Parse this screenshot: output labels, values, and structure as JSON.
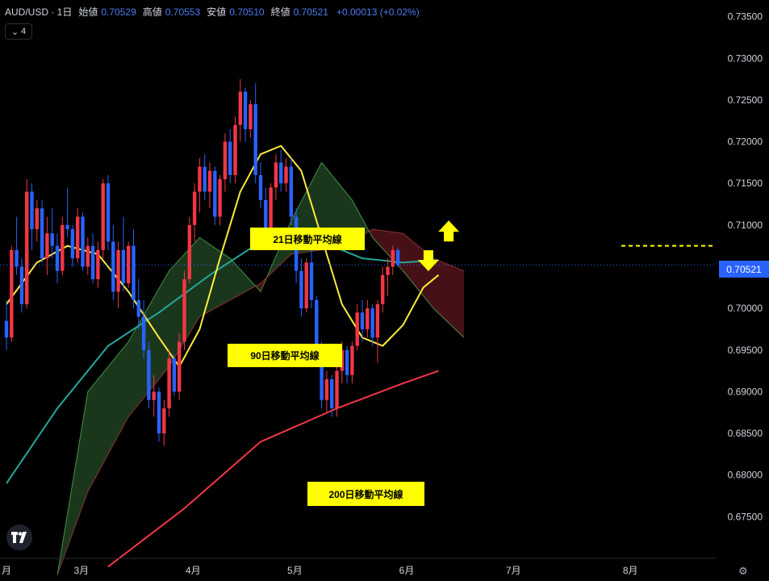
{
  "header": {
    "symbol": "AUD/USD · 1日",
    "open_label": "始値",
    "open": "0.70529",
    "high_label": "高値",
    "high": "0.70553",
    "low_label": "安値",
    "low": "0.70510",
    "close_label": "終値",
    "close": "0.70521",
    "change": "+0.00013 (+0.02%)"
  },
  "collapse_control": {
    "label": "4"
  },
  "current_price": "0.70521",
  "annotations": {
    "ma21": "21日移動平均線",
    "ma90": "90日移動平均線",
    "ma200": "200日移動平均線"
  },
  "icons": {
    "logo": "tradingview-logo-icon",
    "settings": "gear-icon"
  },
  "chart_data": {
    "type": "candlestick",
    "y_range": [
      0.67,
      0.737
    ],
    "y_ticks": [
      "0.73500",
      "0.73000",
      "0.72500",
      "0.72000",
      "0.71500",
      "0.71000",
      "0.70500",
      "0.70000",
      "0.69500",
      "0.69000",
      "0.68500",
      "0.68000",
      "0.67500"
    ],
    "x_labels": [
      {
        "label": "3月",
        "bar": 16
      },
      {
        "label": "4月",
        "bar": 38
      },
      {
        "label": "5月",
        "bar": 58
      },
      {
        "label": "6月",
        "bar": 80
      },
      {
        "label": "7月",
        "bar": 101
      },
      {
        "label": "8月",
        "bar": 124
      }
    ],
    "x_labels_prefix": "月",
    "colors": {
      "up": "#f23645",
      "down": "#2962ff",
      "ma21": "#ffeb3b",
      "ma90": "#26a69a",
      "ma200": "#f23645",
      "kijun_like": "#7cb342",
      "cloud_bull": "#1b3a1e",
      "cloud_bear": "#4a1217",
      "price_line": "#2962ff",
      "arrow": "#ffff00"
    },
    "candles": [
      [
        0.6985,
        0.701,
        0.695,
        0.6965
      ],
      [
        0.6965,
        0.7075,
        0.696,
        0.707
      ],
      [
        0.707,
        0.711,
        0.704,
        0.705
      ],
      [
        0.705,
        0.706,
        0.6995,
        0.7005
      ],
      [
        0.7005,
        0.7155,
        0.7,
        0.714
      ],
      [
        0.714,
        0.715,
        0.707,
        0.7095
      ],
      [
        0.7095,
        0.713,
        0.708,
        0.712
      ],
      [
        0.712,
        0.713,
        0.7055,
        0.706
      ],
      [
        0.706,
        0.711,
        0.704,
        0.709
      ],
      [
        0.709,
        0.712,
        0.706,
        0.7075
      ],
      [
        0.7075,
        0.709,
        0.703,
        0.7045
      ],
      [
        0.7045,
        0.711,
        0.704,
        0.71
      ],
      [
        0.71,
        0.7145,
        0.7085,
        0.7095
      ],
      [
        0.7095,
        0.71,
        0.705,
        0.706
      ],
      [
        0.706,
        0.712,
        0.7055,
        0.711
      ],
      [
        0.711,
        0.7115,
        0.7045,
        0.705
      ],
      [
        0.705,
        0.7085,
        0.704,
        0.7075
      ],
      [
        0.7075,
        0.709,
        0.703,
        0.7035
      ],
      [
        0.7035,
        0.708,
        0.7025,
        0.707
      ],
      [
        0.707,
        0.7155,
        0.706,
        0.715
      ],
      [
        0.715,
        0.716,
        0.707,
        0.708
      ],
      [
        0.708,
        0.71,
        0.701,
        0.702
      ],
      [
        0.702,
        0.708,
        0.7,
        0.707
      ],
      [
        0.707,
        0.711,
        0.702,
        0.703
      ],
      [
        0.703,
        0.708,
        0.7025,
        0.7075
      ],
      [
        0.7075,
        0.7095,
        0.7,
        0.701
      ],
      [
        0.701,
        0.7035,
        0.6975,
        0.699
      ],
      [
        0.699,
        0.701,
        0.694,
        0.695
      ],
      [
        0.695,
        0.696,
        0.688,
        0.689
      ],
      [
        0.689,
        0.692,
        0.687,
        0.69
      ],
      [
        0.69,
        0.6905,
        0.684,
        0.685
      ],
      [
        0.685,
        0.689,
        0.6835,
        0.688
      ],
      [
        0.688,
        0.695,
        0.687,
        0.694
      ],
      [
        0.694,
        0.6945,
        0.6895,
        0.69
      ],
      [
        0.69,
        0.697,
        0.689,
        0.696
      ],
      [
        0.696,
        0.7045,
        0.695,
        0.7035
      ],
      [
        0.7035,
        0.711,
        0.703,
        0.71
      ],
      [
        0.71,
        0.715,
        0.708,
        0.714
      ],
      [
        0.714,
        0.718,
        0.7115,
        0.717
      ],
      [
        0.717,
        0.7185,
        0.713,
        0.714
      ],
      [
        0.714,
        0.7175,
        0.712,
        0.7165
      ],
      [
        0.7165,
        0.717,
        0.71,
        0.711
      ],
      [
        0.711,
        0.716,
        0.71,
        0.7155
      ],
      [
        0.7155,
        0.721,
        0.714,
        0.72
      ],
      [
        0.72,
        0.7215,
        0.715,
        0.716
      ],
      [
        0.716,
        0.723,
        0.715,
        0.722
      ],
      [
        0.722,
        0.7275,
        0.72,
        0.726
      ],
      [
        0.726,
        0.7265,
        0.72,
        0.7215
      ],
      [
        0.7215,
        0.725,
        0.7205,
        0.7245
      ],
      [
        0.7245,
        0.727,
        0.715,
        0.716
      ],
      [
        0.716,
        0.7175,
        0.712,
        0.713
      ],
      [
        0.713,
        0.7145,
        0.708,
        0.7095
      ],
      [
        0.7095,
        0.715,
        0.709,
        0.7145
      ],
      [
        0.7145,
        0.7185,
        0.713,
        0.7175
      ],
      [
        0.7175,
        0.719,
        0.714,
        0.715
      ],
      [
        0.715,
        0.718,
        0.714,
        0.717
      ],
      [
        0.717,
        0.718,
        0.71,
        0.711
      ],
      [
        0.711,
        0.712,
        0.703,
        0.7045
      ],
      [
        0.7045,
        0.706,
        0.699,
        0.7
      ],
      [
        0.7,
        0.706,
        0.6995,
        0.7055
      ],
      [
        0.7055,
        0.707,
        0.7,
        0.701
      ],
      [
        0.701,
        0.7015,
        0.694,
        0.695
      ],
      [
        0.695,
        0.696,
        0.688,
        0.689
      ],
      [
        0.689,
        0.6925,
        0.6875,
        0.6915
      ],
      [
        0.6915,
        0.692,
        0.687,
        0.688
      ],
      [
        0.688,
        0.693,
        0.687,
        0.6925
      ],
      [
        0.6925,
        0.696,
        0.691,
        0.695
      ],
      [
        0.695,
        0.6955,
        0.691,
        0.692
      ],
      [
        0.692,
        0.696,
        0.691,
        0.6955
      ],
      [
        0.6955,
        0.7005,
        0.695,
        0.6995
      ],
      [
        0.6995,
        0.701,
        0.696,
        0.6975
      ],
      [
        0.6975,
        0.701,
        0.6965,
        0.7
      ],
      [
        0.7,
        0.7005,
        0.6955,
        0.6965
      ],
      [
        0.6965,
        0.701,
        0.6935,
        0.7005
      ],
      [
        0.7005,
        0.705,
        0.6995,
        0.704
      ],
      [
        0.704,
        0.706,
        0.7015,
        0.705
      ],
      [
        0.705,
        0.7075,
        0.704,
        0.707
      ],
      [
        0.707,
        0.7072,
        0.705,
        0.7052
      ]
    ],
    "ma21": [
      [
        0,
        0.7005
      ],
      [
        6,
        0.7055
      ],
      [
        12,
        0.7075
      ],
      [
        18,
        0.7065
      ],
      [
        24,
        0.702
      ],
      [
        30,
        0.6965
      ],
      [
        34,
        0.693
      ],
      [
        38,
        0.6975
      ],
      [
        42,
        0.706
      ],
      [
        46,
        0.714
      ],
      [
        50,
        0.7185
      ],
      [
        54,
        0.7195
      ],
      [
        58,
        0.7165
      ],
      [
        62,
        0.7085
      ],
      [
        66,
        0.7005
      ],
      [
        70,
        0.6965
      ],
      [
        74,
        0.6955
      ],
      [
        78,
        0.698
      ],
      [
        82,
        0.7025
      ],
      [
        85,
        0.704
      ]
    ],
    "ma90": [
      [
        0,
        0.679
      ],
      [
        10,
        0.688
      ],
      [
        20,
        0.6955
      ],
      [
        30,
        0.6995
      ],
      [
        40,
        0.704
      ],
      [
        50,
        0.708
      ],
      [
        60,
        0.7085
      ],
      [
        70,
        0.706
      ],
      [
        78,
        0.7055
      ],
      [
        85,
        0.7058
      ]
    ],
    "ma200": [
      [
        20,
        0.669
      ],
      [
        35,
        0.676
      ],
      [
        50,
        0.684
      ],
      [
        65,
        0.688
      ],
      [
        78,
        0.691
      ],
      [
        85,
        0.6925
      ]
    ],
    "cloud": {
      "span_a": [
        [
          10,
          0.668
        ],
        [
          16,
          0.69
        ],
        [
          24,
          0.696
        ],
        [
          32,
          0.7045
        ],
        [
          38,
          0.7085
        ],
        [
          44,
          0.706
        ],
        [
          50,
          0.702
        ],
        [
          56,
          0.7105
        ],
        [
          62,
          0.7175
        ],
        [
          68,
          0.713
        ],
        [
          72,
          0.7085
        ],
        [
          78,
          0.7045
        ],
        [
          84,
          0.7
        ],
        [
          90,
          0.6965
        ]
      ],
      "span_b": [
        [
          10,
          0.668
        ],
        [
          16,
          0.678
        ],
        [
          24,
          0.687
        ],
        [
          32,
          0.693
        ],
        [
          38,
          0.699
        ],
        [
          44,
          0.701
        ],
        [
          50,
          0.703
        ],
        [
          56,
          0.7065
        ],
        [
          62,
          0.707
        ],
        [
          68,
          0.708
        ],
        [
          72,
          0.7095
        ],
        [
          78,
          0.709
        ],
        [
          84,
          0.706
        ],
        [
          90,
          0.7045
        ]
      ]
    },
    "annotated_level": 0.7075,
    "arrows": [
      {
        "direction": "up",
        "bar": 87,
        "price": 0.709
      },
      {
        "direction": "down",
        "bar": 83,
        "price": 0.706
      }
    ]
  }
}
